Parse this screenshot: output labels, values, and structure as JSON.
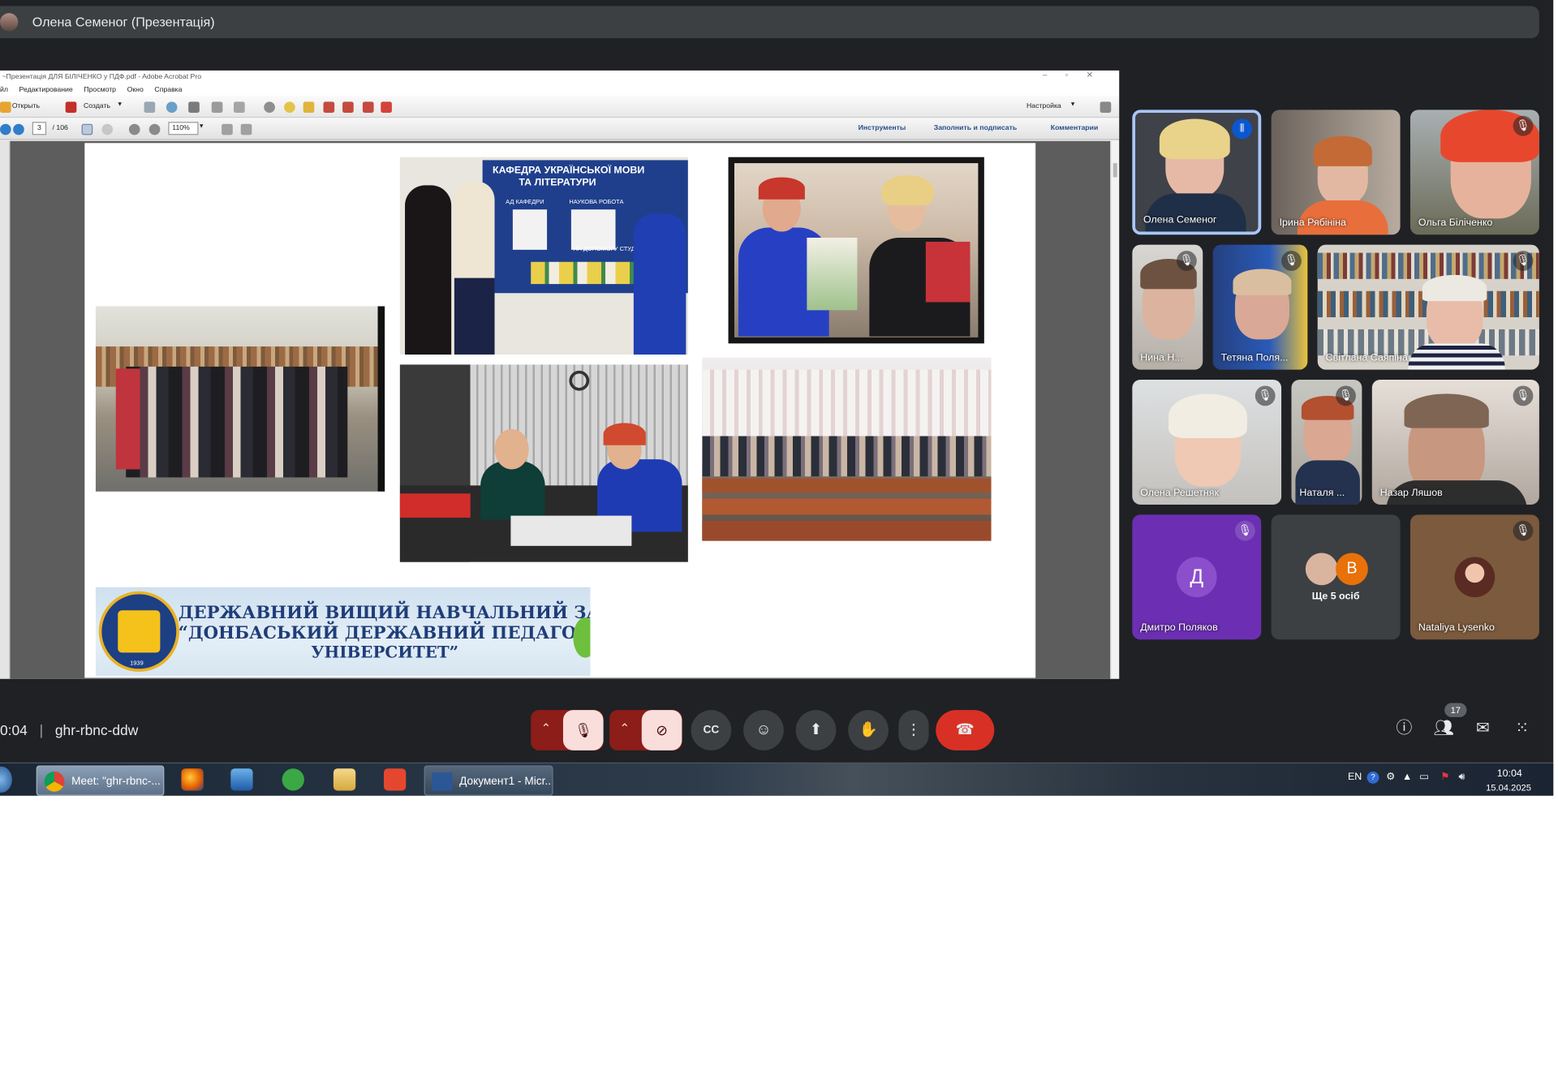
{
  "presenter_bar": {
    "name": "Олена Семеног (Презентація)"
  },
  "acrobat": {
    "title": "~Презентація ДЛЯ БІЛІЧЕНКО у ПДФ.pdf - Adobe Acrobat Pro",
    "menu": [
      "йл",
      "Редактирование",
      "Просмотр",
      "Окно",
      "Справка"
    ],
    "open_label": "Открыть",
    "create_label": "Создать",
    "settings_label": "Настройка",
    "page_current": "3",
    "page_total": "/ 106",
    "zoom": "110%",
    "panel_tools": "Инструменты",
    "panel_fill_sign": "Заполнить и подписать",
    "panel_comments": "Комментарии"
  },
  "slide": {
    "stand_header_1": "КАФЕДРА УКРАЇНСЬКОЇ МОВИ",
    "stand_header_2": "ТА ЛІТЕРАТУРИ",
    "stand_col_1": "АД КАФЕДРИ",
    "stand_col_2": "НАУКОВА РОБОТА",
    "stand_bottom": "НА ДОПОМОГУ СТУДЕ",
    "banner_line_1": "ДЕРЖАВНИЙ ВИЩИЙ НАВЧАЛЬНИЙ ЗАКЛАД",
    "banner_line_2": "“ДОНБАСЬКИЙ ДЕРЖАВНИЙ ПЕДАГОГІЧНИЙ",
    "banner_line_3": "УНІВЕРСИТЕТ”",
    "seal_year": "1939"
  },
  "participants": [
    {
      "name": "Олена Семеног",
      "speaking": true
    },
    {
      "name": "Ірина Рябініна"
    },
    {
      "name": "Ольга Біліченко",
      "muted": true
    },
    {
      "name": "Нина Н...",
      "muted": true
    },
    {
      "name": "Тетяна Поля...",
      "muted": true
    },
    {
      "name": "Світлана Саяпіна",
      "muted": true
    },
    {
      "name": "Олена Решетняк",
      "muted": true
    },
    {
      "name": "Наталя ...",
      "muted": true
    },
    {
      "name": "Назар Ляшов",
      "muted": true
    },
    {
      "name": "Дмитро Поляков",
      "muted": true,
      "initial": "Д"
    },
    {
      "name": "Ще 5 осіб",
      "initial": "В"
    },
    {
      "name": "Nataliya Lysenko",
      "muted": true
    }
  ],
  "meeting": {
    "time": "0:04",
    "separator": "|",
    "code": "ghr-rbnc-ddw",
    "people_count": "17"
  },
  "taskbar": {
    "chrome_label": "Meet: \"ghr-rbnc-...",
    "word_label": "Документ1 - Micr...",
    "lang": "EN",
    "clock_time": "10:04",
    "clock_date": "15.04.2025"
  },
  "colors": {
    "meet_bg": "#202124",
    "end_call": "#d93025",
    "rail": "#8c1d18",
    "muted_pill": "#f9dedc",
    "active_speaker_border": "#a8c7fa"
  }
}
